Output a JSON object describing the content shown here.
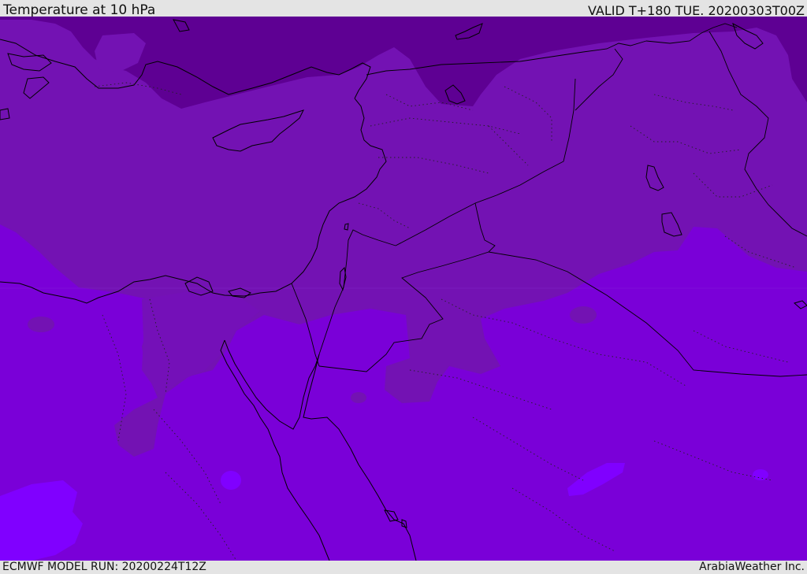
{
  "header": {
    "title": "Temperature at 10 hPa",
    "valid": "VALID T+180 TUE. 20200303T00Z"
  },
  "footer": {
    "model_run": "ECMWF MODEL RUN: 20200224T12Z",
    "credit": "ArabiaWeather Inc."
  },
  "map": {
    "layer": "temperature",
    "level": "10 hPa",
    "colors": {
      "coldest": "#5e0093",
      "cold": "#7312b3",
      "band_mid": "#720fc0",
      "warm": "#7a00d8",
      "warmest": "#8000ff",
      "coastline": "#000000"
    }
  }
}
